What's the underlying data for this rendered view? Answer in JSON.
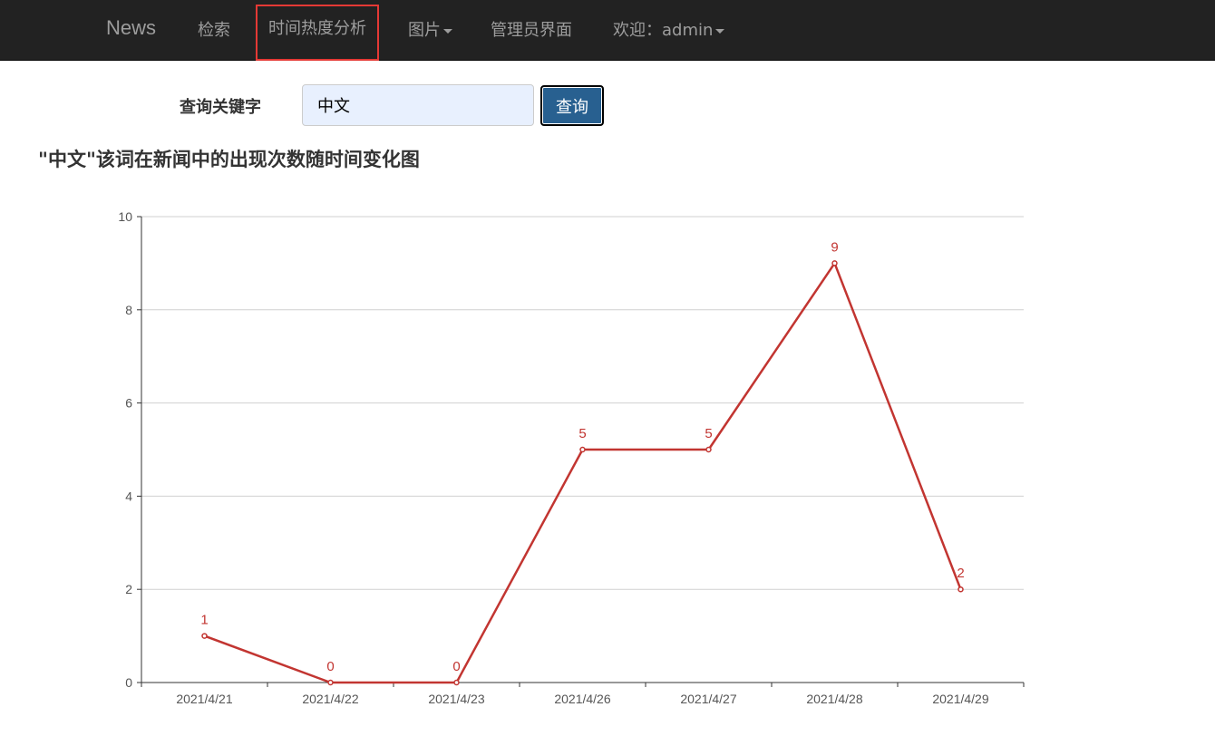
{
  "nav": {
    "brand": "News",
    "items": [
      {
        "label": "检索"
      },
      {
        "label": "时间热度分析"
      },
      {
        "label": "图片"
      },
      {
        "label": "管理员界面"
      },
      {
        "label": "欢迎：admin"
      }
    ]
  },
  "search": {
    "label": "查询关键字",
    "value": "中文",
    "button": "查询"
  },
  "chart_title": "\"中文\"该词在新闻中的出现次数随时间变化图",
  "colors": {
    "navbar": "#222222",
    "nav_text": "#9d9d9d",
    "highlight_border": "#e53935",
    "button": "#286090",
    "line": "#c23531"
  },
  "chart_data": {
    "type": "line",
    "title": "\"中文\"该词在新闻中的出现次数随时间变化图",
    "categories": [
      "2021/4/21",
      "2021/4/22",
      "2021/4/23",
      "2021/4/26",
      "2021/4/27",
      "2021/4/28",
      "2021/4/29"
    ],
    "series": [
      {
        "values": [
          1,
          0,
          0,
          5,
          5,
          9,
          2
        ]
      }
    ],
    "ylim": [
      0,
      10
    ],
    "yticks": [
      0,
      2,
      4,
      6,
      8,
      10
    ],
    "grid": true,
    "data_labels": true
  }
}
